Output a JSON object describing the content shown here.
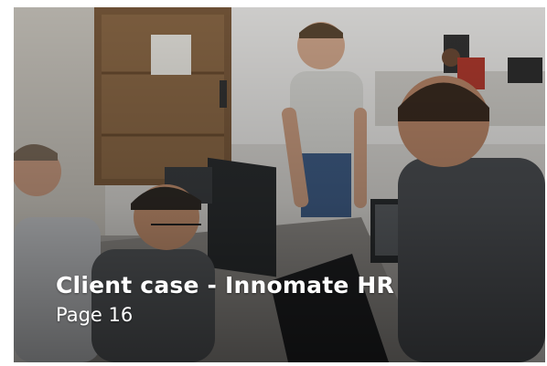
{
  "card": {
    "title": "Client case - Innomate HR",
    "page_label": "Page 16",
    "image": "office-team-photo"
  },
  "colors": {
    "caption_text": "#ffffff",
    "overlay": "#000000"
  }
}
